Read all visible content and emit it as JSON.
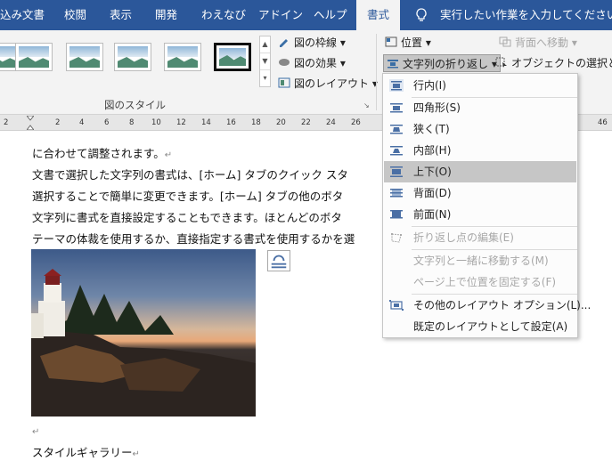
{
  "tabs": [
    {
      "label": "込み文書"
    },
    {
      "label": "校閲"
    },
    {
      "label": "表示"
    },
    {
      "label": "開発"
    },
    {
      "label": "わえなび"
    },
    {
      "label": "アドイン"
    },
    {
      "label": "ヘルプ"
    },
    {
      "label": "書式",
      "active": true
    }
  ],
  "tell_me": "実行したい作業を入力してください",
  "ribbon": {
    "border": "図の枠線",
    "effects": "図の効果",
    "layout": "図のレイアウト",
    "styles_group": "図のスタイル",
    "position": "位置",
    "wrap_text": "文字列の折り返し",
    "send_back": "背面へ移動",
    "selection_pane": "オブジェクトの選択と表示"
  },
  "ruler": {
    "ticks": [
      "2",
      "2",
      "4",
      "6",
      "8",
      "10",
      "12",
      "14",
      "16",
      "18",
      "20",
      "22",
      "24",
      "26",
      "46"
    ]
  },
  "document": {
    "lines": [
      "に合わせて調整されます。",
      "文書で選択した文字列の書式は、[ホーム] タブのクイック スタ",
      "選択することで簡単に変更できます。[ホーム] タブの他のボタ",
      "文字列に書式を直接設定することもできます。ほとんどのボタ",
      "テーマの体裁を使用するか、直接指定する書式を使用するかを選"
    ],
    "caption": "スタイルギャラリー",
    "return_mark": "↵"
  },
  "wrap_menu": {
    "items": [
      {
        "label": "行内(I)",
        "icon": "inline-icon",
        "enabled": true
      },
      {
        "label": "四角形(S)",
        "icon": "square-icon",
        "enabled": true
      },
      {
        "label": "狭く(T)",
        "icon": "tight-icon",
        "enabled": true
      },
      {
        "label": "内部(H)",
        "icon": "through-icon",
        "enabled": true
      },
      {
        "label": "上下(O)",
        "icon": "top-bottom-icon",
        "enabled": true,
        "highlighted": true
      },
      {
        "label": "背面(D)",
        "icon": "behind-text-icon",
        "enabled": true
      },
      {
        "label": "前面(N)",
        "icon": "in-front-icon",
        "enabled": true
      },
      {
        "label": "折り返し点の編集(E)",
        "icon": "edit-wrap-points-icon",
        "enabled": false
      },
      {
        "label": "文字列と一緒に移動する(M)",
        "icon": "",
        "enabled": false
      },
      {
        "label": "ページ上で位置を固定する(F)",
        "icon": "",
        "enabled": false
      },
      {
        "label": "その他のレイアウト オプション(L)...",
        "icon": "layout-options-icon",
        "enabled": true
      },
      {
        "label": "既定のレイアウトとして設定(A)",
        "icon": "",
        "enabled": true
      }
    ]
  },
  "colors": {
    "ribbon_blue": "#2b579a",
    "highlight": "#c6c6c6"
  }
}
